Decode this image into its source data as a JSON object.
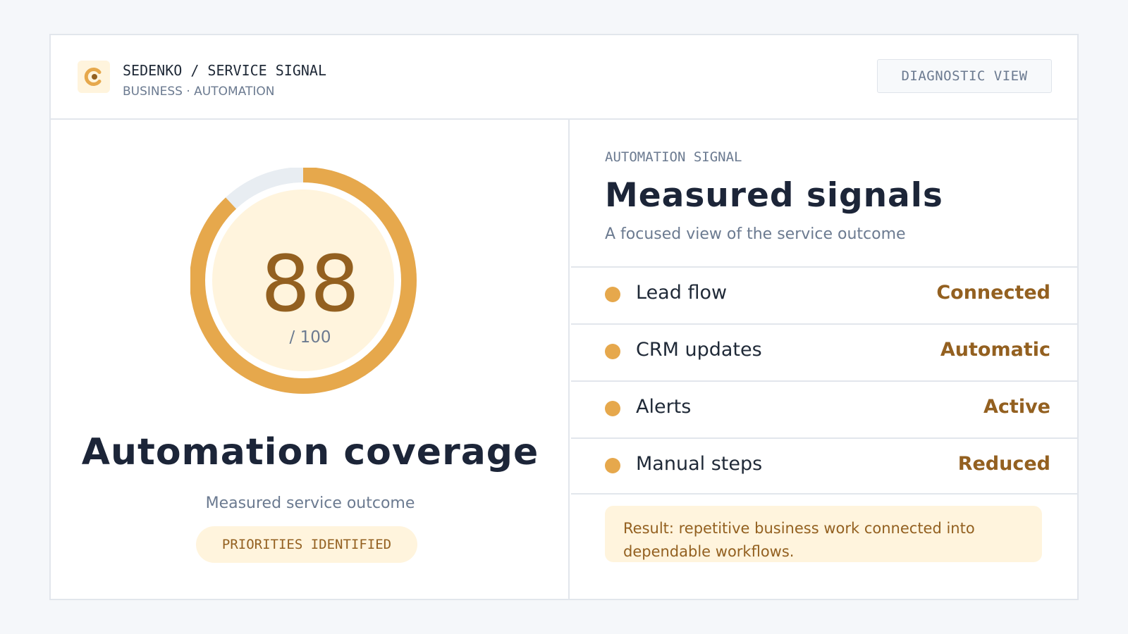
{
  "header": {
    "brand_title": "SEDENKO / SERVICE SIGNAL",
    "brand_subtitle": "BUSINESS · AUTOMATION",
    "logo_icon": "sedenko-logo-icon",
    "diagnostic_button": "DIAGNOSTIC VIEW"
  },
  "gauge": {
    "value": "88",
    "value_number": 88,
    "max_label": "/ 100",
    "max_number": 100
  },
  "coverage": {
    "title": "Automation coverage",
    "subtitle": "Measured service outcome",
    "badge": "PRIORITIES IDENTIFIED"
  },
  "signals": {
    "eyebrow": "AUTOMATION SIGNAL",
    "title": "Measured signals",
    "subtitle": "A focused view of the service outcome",
    "rows": [
      {
        "label": "Lead flow",
        "value": "Connected"
      },
      {
        "label": "CRM updates",
        "value": "Automatic"
      },
      {
        "label": "Alerts",
        "value": "Active"
      },
      {
        "label": "Manual steps",
        "value": "Reduced"
      }
    ],
    "result": "Result: repetitive business work connected into dependable workflows."
  },
  "colors": {
    "accent": "#e6a84c",
    "accent_dark": "#936020",
    "accent_soft": "#fff4dd",
    "track": "#e8edf2",
    "text_dark": "#1c2538",
    "text_muted": "#6b7a90"
  }
}
